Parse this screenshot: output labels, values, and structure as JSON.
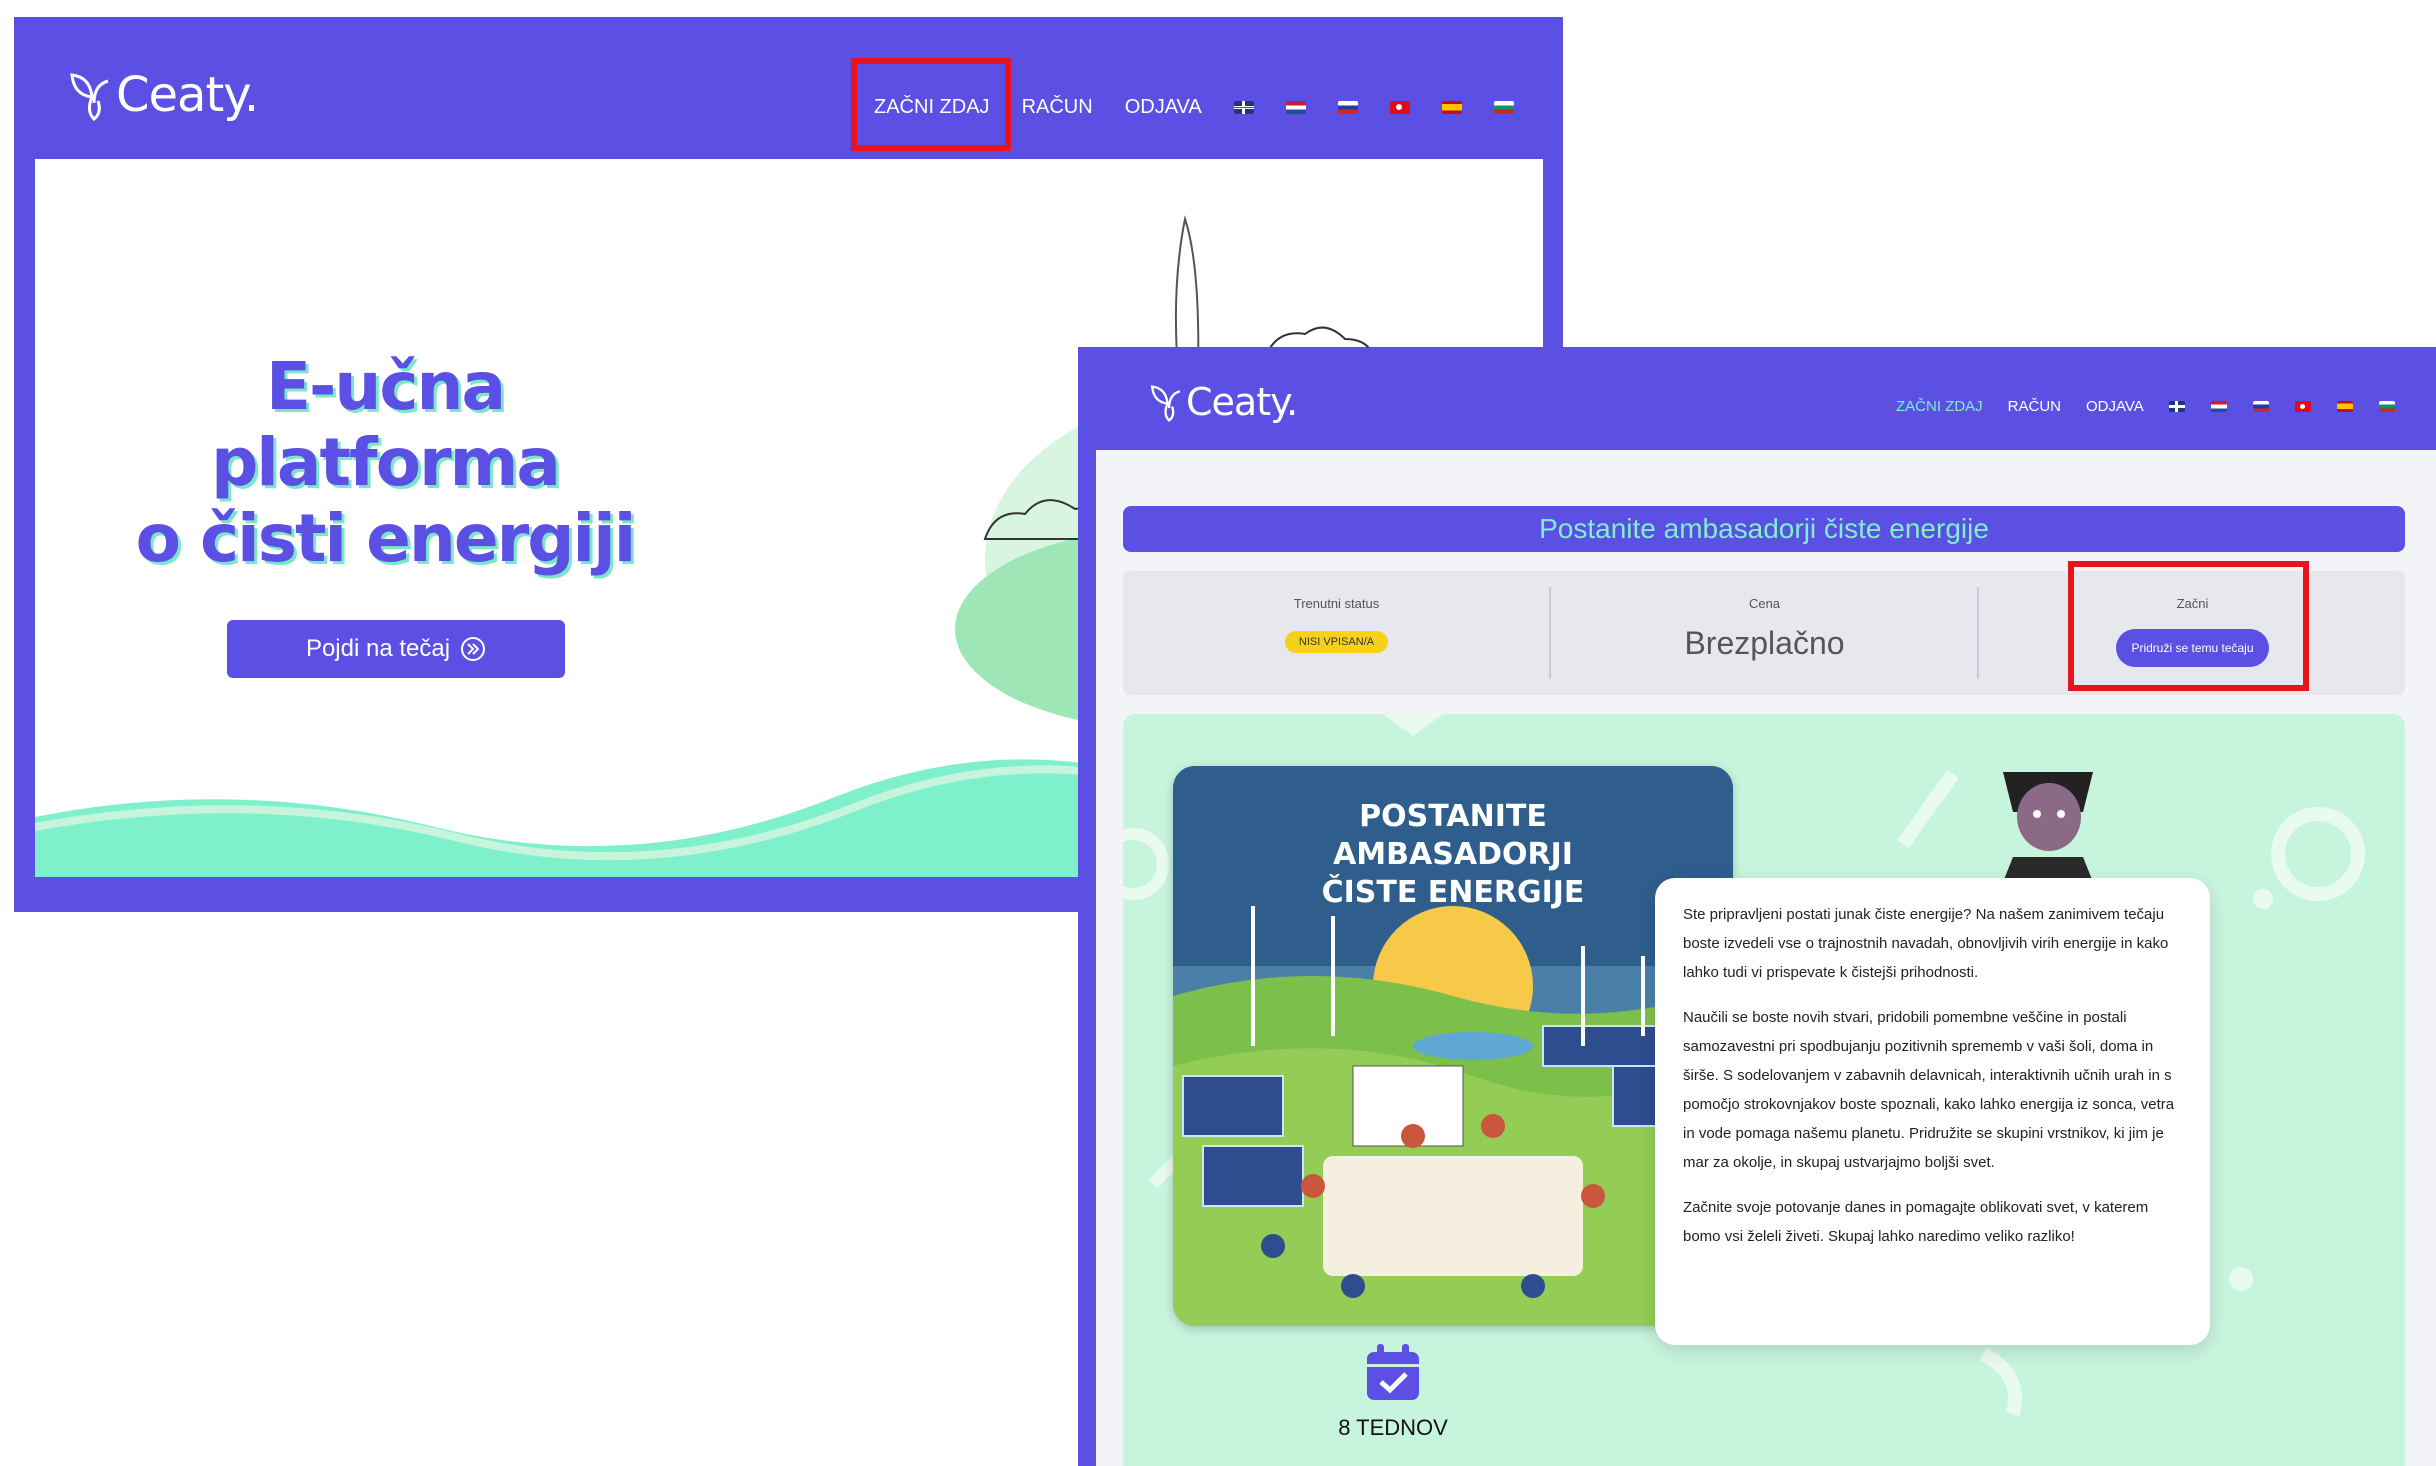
{
  "window1": {
    "logo": "Ceaty.",
    "nav": {
      "start": "ZAČNI ZDAJ",
      "account": "RAČUN",
      "logout": "ODJAVA"
    },
    "hero": {
      "line1": "E-učna",
      "line2": "platforma",
      "line3": "o čisti energiji",
      "cta": "Pojdi na tečaj"
    }
  },
  "window2": {
    "logo": "Ceaty.",
    "nav": {
      "start": "ZAČNI ZDAJ",
      "account": "RAČUN",
      "logout": "ODJAVA"
    },
    "course_title": "Postanite ambasadorji čiste energije",
    "status": {
      "current_label": "Trenutni status",
      "current_value": "NISI VPISAN/A",
      "price_label": "Cena",
      "price_value": "Brezplačno",
      "start_label": "Začni",
      "start_button": "Pridruži se temu tečaju"
    },
    "poster": {
      "line1": "POSTANITE",
      "line2": "AMBASADORJI",
      "line3": "ČISTE ENERGIJE"
    },
    "description": {
      "p1": "Ste pripravljeni postati junak čiste energije? Na našem zanimivem tečaju boste izvedeli vse o trajnostnih navadah, obnovljivih virih energije in kako lahko tudi vi prispevate k čistejši prihodnosti.",
      "p2": "Naučili se boste novih stvari, pridobili pomembne veščine in postali samozavestni pri spodbujanju pozitivnih sprememb v vaši šoli, doma in širše. S sodelovanjem v zabavnih delavnicah, interaktivnih učnih urah in s pomočjo strokovnjakov boste spoznali, kako lahko energija iz sonca, vetra in vode pomaga našemu planetu. Pridružite se skupini vrstnikov, ki jim je mar za okolje, in skupaj ustvarjajmo boljši svet.",
      "p3": "Začnite svoje potovanje danes in pomagajte oblikovati svet, v katerem bomo vsi želeli živeti. Skupaj lahko naredimo veliko razliko!"
    },
    "duration": "8 TEDNOV"
  },
  "colors": {
    "brand": "#5b50e3",
    "mint": "#7ff0cc",
    "highlight": "#e8141b",
    "badge": "#f5d21a"
  },
  "flags": [
    "uk-flag-icon",
    "netherlands-flag-icon",
    "slovenia-flag-icon",
    "turkey-flag-icon",
    "spain-flag-icon",
    "bulgaria-flag-icon"
  ]
}
